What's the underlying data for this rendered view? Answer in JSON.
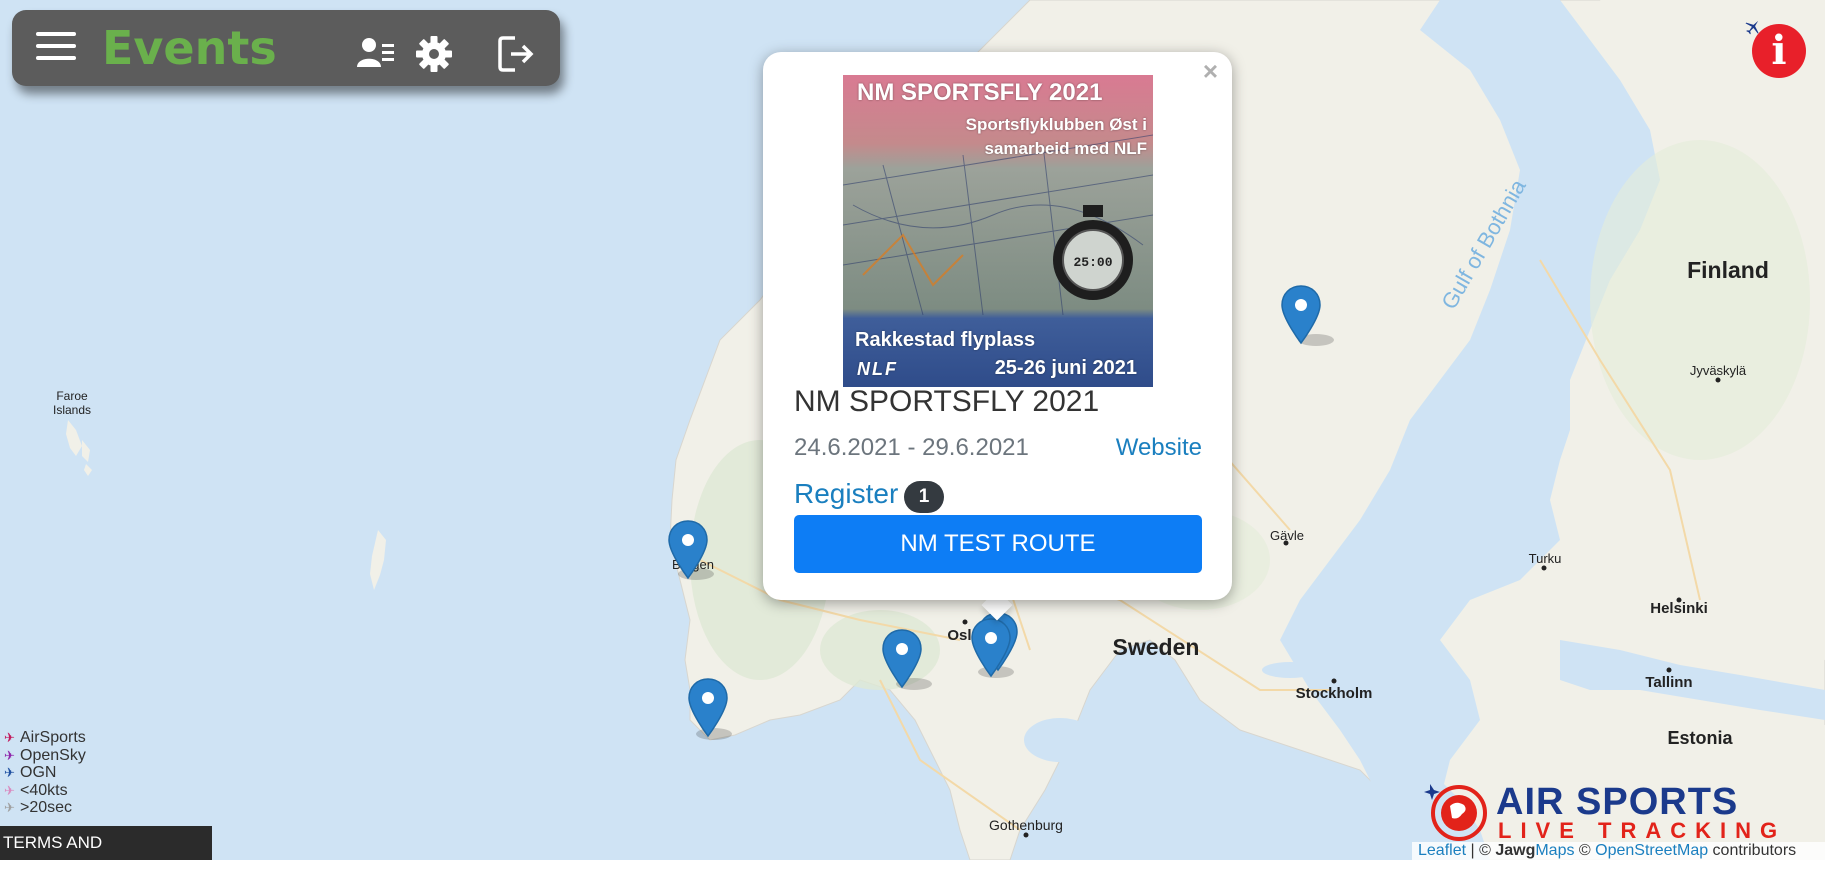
{
  "navbar": {
    "title": "Events"
  },
  "map": {
    "labels": {
      "faroe_1": "Faroe",
      "faroe_2": "Islands",
      "finland": "Finland",
      "sweden": "Sweden",
      "estonia": "Estonia",
      "gulf": "Gulf of Bothnia",
      "jyvaskyla": "Jyväskylä",
      "gavle": "Gävle",
      "turku": "Turku",
      "helsinki": "Helsinki",
      "tallinn": "Tallinn",
      "stockholm": "Stockholm",
      "oslo": "Oslo",
      "bergen": "Bergen",
      "gothenburg": "Gothenburg"
    }
  },
  "popup": {
    "close_label": "×",
    "poster": {
      "title": "NM SPORTSFLY 2021",
      "subtitle_1": "Sportsflyklubben Øst i",
      "subtitle_2": "samarbeid med NLF",
      "place": "Rakkestad  flyplass",
      "dates": "25-26 juni 2021",
      "logo_text": "NLF",
      "stopwatch": "25:00"
    },
    "event_name": "NM SPORTSFLY 2021",
    "dates": "24.6.2021 - 29.6.2021",
    "website_label": "Website",
    "register_label": "Register",
    "register_count": "1",
    "route_button": "NM TEST ROUTE"
  },
  "info_button": {
    "label": "i"
  },
  "legend": [
    {
      "label": "AirSports",
      "color": "#c2185b"
    },
    {
      "label": "OpenSky",
      "color": "#8e24aa"
    },
    {
      "label": "OGN",
      "color": "#1e4fa0"
    },
    {
      "label": "<40kts",
      "color": "#d98bc0"
    },
    {
      "label": ">20sec",
      "color": "#a0a0a0"
    }
  ],
  "terms_label": "TERMS AND CONDITIONS",
  "brand": {
    "line1": "AIR SPORTS",
    "line2": "LIVE TRACKING",
    "red": "#e2231a",
    "blue": "#1b3a8c"
  },
  "attribution": {
    "leaflet": "Leaflet",
    "sep1": " | © ",
    "jawg_bold": "Jawg",
    "jawg_rest": "Maps",
    "sep2": " © ",
    "osm": "OpenStreetMap",
    "tail": " contributors"
  },
  "colors": {
    "water": "#cfe3f4",
    "land": "#f2f1ea",
    "nav_bg": "#5c5c5c",
    "title_green": "#6ab04c",
    "marker_blue": "#2a81cb",
    "button_blue": "#0d7df5"
  }
}
